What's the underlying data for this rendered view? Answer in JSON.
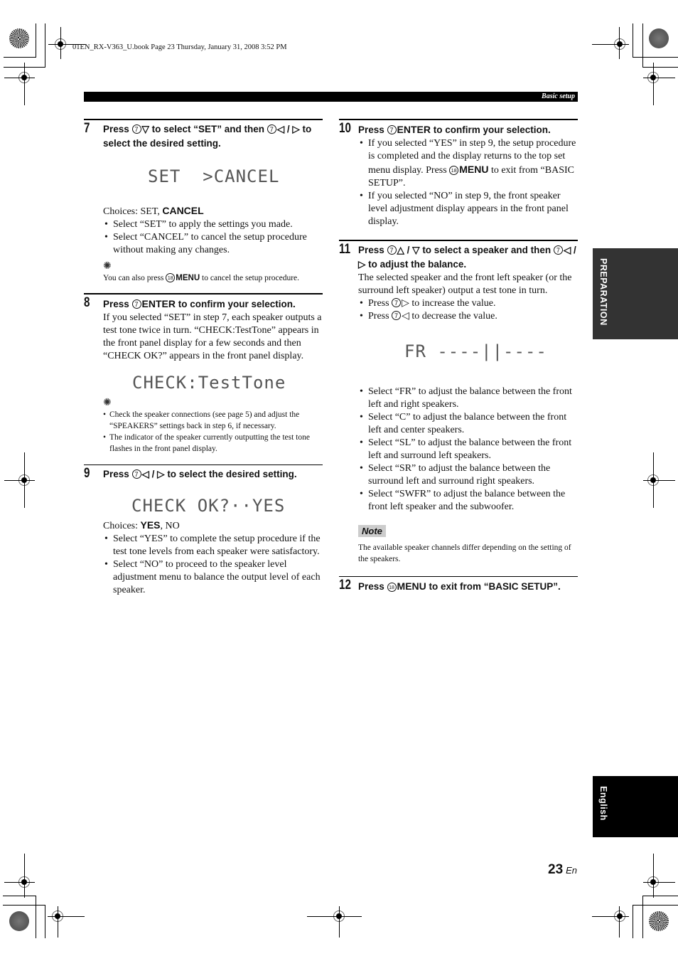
{
  "file_header": "01EN_RX-V363_U.book  Page 23  Thursday, January 31, 2008  3:52 PM",
  "section_header": "Basic setup",
  "side_tabs": {
    "preparation": "PREPARATION",
    "english": "English"
  },
  "page": {
    "number": "23",
    "lang": "En"
  },
  "icons": {
    "key7": "7",
    "key18": "18",
    "tip": "✺"
  },
  "left": {
    "step7": {
      "num": "7",
      "title_a": "Press ",
      "title_b": "▽ to select “SET” and then ",
      "title_c": "◁ / ▷ to select the desired setting.",
      "lcd": "SET  >CANCEL",
      "choices_prefix": "Choices: SET, ",
      "choices_bold": "CANCEL",
      "bullets": [
        "Select “SET” to apply the settings you made.",
        "Select “CANCEL” to cancel the setup procedure without making any changes."
      ],
      "tip_a": "You can also press ",
      "tip_menu": "MENU",
      "tip_b": " to cancel the setup procedure."
    },
    "step8": {
      "num": "8",
      "title_a": "Press ",
      "title_enter": "ENTER",
      "title_b": " to confirm your selection.",
      "body": "If you selected “SET” in step 7, each speaker outputs a test tone twice in turn. “CHECK:TestTone” appears in the front panel display for a few seconds and then “CHECK OK?” appears in the front panel display.",
      "lcd": "CHECK:TestTone",
      "tips": [
        "Check the speaker connections (see page 5) and adjust the “SPEAKERS” settings back in step 6, if necessary.",
        "The indicator of the speaker currently outputting the test tone flashes in the front panel display."
      ]
    },
    "step9": {
      "num": "9",
      "title_a": "Press ",
      "title_b": "◁ / ▷ to select the desired setting.",
      "lcd": "CHECK OK?··YES",
      "choices_prefix": "Choices: ",
      "choices_bold": "YES",
      "choices_suffix": ", NO",
      "bullets": [
        "Select “YES” to complete the setup procedure if the test tone levels from each speaker were satisfactory.",
        "Select “NO” to proceed to the speaker level adjustment menu to balance the output level of each speaker."
      ]
    }
  },
  "right": {
    "step10": {
      "num": "10",
      "title_a": "Press ",
      "title_enter": "ENTER",
      "title_b": " to confirm your selection.",
      "b1_a": "If you selected “YES” in step 9, the setup procedure is completed and the display returns to the top set menu display. Press ",
      "b1_menu": "MENU",
      "b1_b": " to exit from “BASIC SETUP”.",
      "b2": "If you selected “NO” in step 9, the front speaker level adjustment display appears in the front panel display."
    },
    "step11": {
      "num": "11",
      "title_a": "Press ",
      "title_b": "△ / ▽ to select a speaker and then ",
      "title_c": "◁ / ▷ to adjust the balance.",
      "body": "The selected speaker and the front left speaker (or the surround left speaker) output a test tone in turn.",
      "press_inc_a": "Press ",
      "press_inc_b": "▷ to increase the value.",
      "press_dec_a": "Press ",
      "press_dec_b": "◁ to decrease the value.",
      "lcd": "FR ----||----",
      "bullets": [
        "Select “FR” to adjust the balance between the front left and right speakers.",
        "Select “C” to adjust the balance between the front left and center speakers.",
        "Select “SL” to adjust the balance between the front left and surround left speakers.",
        "Select “SR” to adjust the balance between the surround left and surround right speakers.",
        "Select “SWFR” to adjust the balance between the front left speaker and the subwoofer."
      ]
    },
    "note": {
      "label": "Note",
      "text": "The available speaker channels differ depending on the setting of the speakers."
    },
    "step12": {
      "num": "12",
      "title_a": "Press ",
      "title_menu": "MENU",
      "title_b": " to exit from “BASIC SETUP”."
    }
  }
}
